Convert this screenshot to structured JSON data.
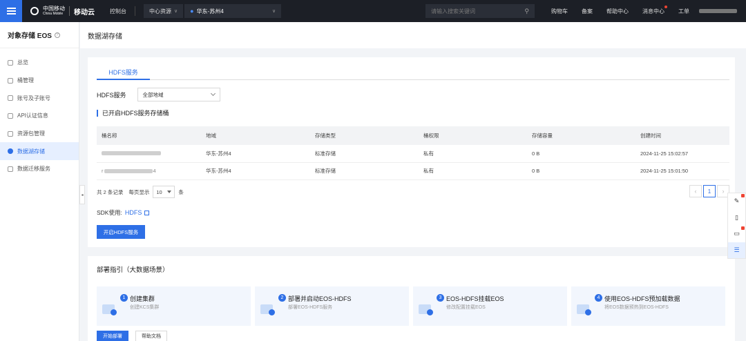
{
  "topbar": {
    "brand_cn": "中国移动",
    "brand_en": "China Mobile",
    "cloud_name": "移动云",
    "console": "控制台",
    "region_btn": "中心资源",
    "region": "华东-苏州4",
    "search_placeholder": "请输入搜索关键词",
    "links": [
      "购物车",
      "备案",
      "帮助中心",
      "消息中心",
      "工单"
    ]
  },
  "sidebar": {
    "title": "对象存储 EOS",
    "items": [
      {
        "label": "总览",
        "icon": "overview-icon"
      },
      {
        "label": "桶管理",
        "icon": "bucket-icon"
      },
      {
        "label": "账号及子账号",
        "icon": "account-icon"
      },
      {
        "label": "API认证信息",
        "icon": "key-icon"
      },
      {
        "label": "资源包管理",
        "icon": "package-icon"
      },
      {
        "label": "数据湖存储",
        "icon": "datalake-icon",
        "active": true
      },
      {
        "label": "数据迁移服务",
        "icon": "migration-icon"
      }
    ]
  },
  "page": {
    "title": "数据湖存储"
  },
  "hdfs": {
    "tab": "HDFS服务",
    "filter_label": "HDFS服务",
    "filter_value": "全部地域",
    "section_title": "已开启HDFS服务存储桶",
    "columns": [
      "桶名称",
      "地域",
      "存储类型",
      "桶权限",
      "存储容量",
      "创建时间"
    ],
    "rows": [
      {
        "name": "",
        "region": "华东-苏州4",
        "type": "标准存储",
        "acl": "私有",
        "size": "0 B",
        "created": "2024-11-25 15:02:57"
      },
      {
        "name": "r...4",
        "region": "华东-苏州4",
        "type": "标准存储",
        "acl": "私有",
        "size": "0 B",
        "created": "2024-11-25 15:01:50"
      }
    ],
    "total": "共 2 条记录",
    "per_page_label": "每页显示",
    "per_page": "10",
    "per_page_unit": "条",
    "current_page": "1",
    "sdk_label": "SDK使用:",
    "sdk_link": "HDFS",
    "enable_button": "开启HDFS服务"
  },
  "guide": {
    "title": "部署指引（大数据场景）",
    "steps": [
      {
        "num": "1",
        "title": "创建集群",
        "desc": "创建KCS集群"
      },
      {
        "num": "2",
        "title": "部署并启动EOS-HDFS",
        "desc": "部署EOS-HDFS服务"
      },
      {
        "num": "3",
        "title": "EOS-HDFS挂载EOS",
        "desc": "修改配置挂载EOS"
      },
      {
        "num": "4",
        "title": "使用EOS-HDFS预加载数据",
        "desc": "将EOS数据预热到EOS-HDFS"
      }
    ],
    "start_button": "开始部署",
    "docs_button": "帮助文档"
  },
  "colors": {
    "primary": "#2e6fe6",
    "topbar": "#1c1f26"
  }
}
